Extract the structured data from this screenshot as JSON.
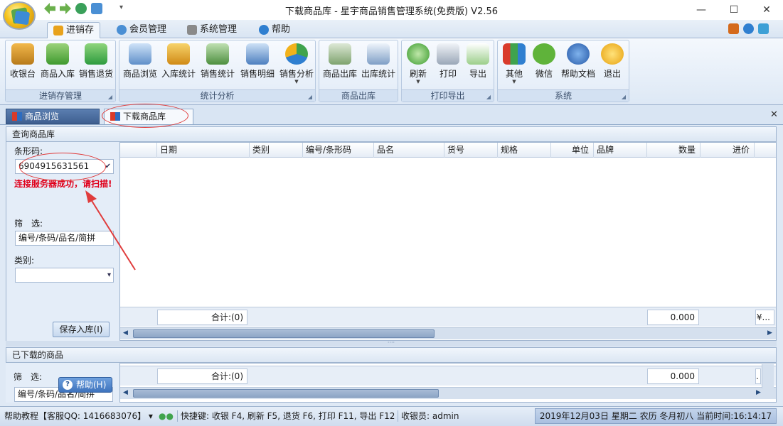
{
  "window": {
    "title": "下载商品库 - 星宇商品销售管理系统(免费版) V2.56",
    "qat_menu": "▾"
  },
  "ribbon_tabs": [
    {
      "label": "进销存"
    },
    {
      "label": "会员管理"
    },
    {
      "label": "系统管理"
    },
    {
      "label": "帮助"
    }
  ],
  "ribbon": {
    "groups": [
      {
        "label": "进销存管理",
        "buttons": [
          "收银台",
          "商品入库",
          "销售退货"
        ]
      },
      {
        "label": "统计分析",
        "buttons": [
          "商品浏览",
          "入库统计",
          "销售统计",
          "销售明细",
          "销售分析"
        ]
      },
      {
        "label": "商品出库",
        "buttons": [
          "商品出库",
          "出库统计"
        ]
      },
      {
        "label": "打印导出",
        "buttons": [
          "刷新",
          "打印",
          "导出"
        ]
      },
      {
        "label": "系统",
        "buttons": [
          "其他",
          "微信",
          "帮助文档",
          "退出"
        ]
      }
    ]
  },
  "doc_tabs": [
    {
      "label": "商品浏览"
    },
    {
      "label": "下载商品库"
    }
  ],
  "query_panel": {
    "title": "查询商品库",
    "barcode_label": "条形码:",
    "barcode_value": "6904915631561",
    "status_message": "连接服务器成功，请扫描!",
    "filter_label": "筛　选:",
    "filter_value": "编号/条码/品名/简拼",
    "category_label": "类别:",
    "category_value": "",
    "save_button": "保存入库(I)"
  },
  "grid": {
    "columns": [
      "日期",
      "类别",
      "编号/条形码",
      "品名",
      "货号",
      "规格",
      "单位",
      "品牌",
      "数量",
      "进价"
    ],
    "footer_total": "合计:(0)",
    "footer_qty": "0.000",
    "footer_price": "¥..."
  },
  "downloaded_panel": {
    "title": "已下载的商品",
    "filter_label": "筛　选:",
    "filter_value": "编号/条码/品名/简拼",
    "help_button": "帮助(H)",
    "footer_total": "合计:(0)",
    "footer_qty": "0.000",
    "footer_price": "."
  },
  "statusbar": {
    "help": "帮助教程【客服QQ: 1416683076】",
    "shortcuts": "快捷键: 收银 F4, 刷新 F5, 退货 F6, 打印 F11, 导出 F12",
    "cashier": "收银员: admin",
    "datetime": "2019年12月03日 星期二 农历 冬月初八 当前时间:16:14:17"
  },
  "colors": {
    "accent": "#3e73bd",
    "status_message": "#e0001b",
    "annotation": "#e03c3c"
  }
}
